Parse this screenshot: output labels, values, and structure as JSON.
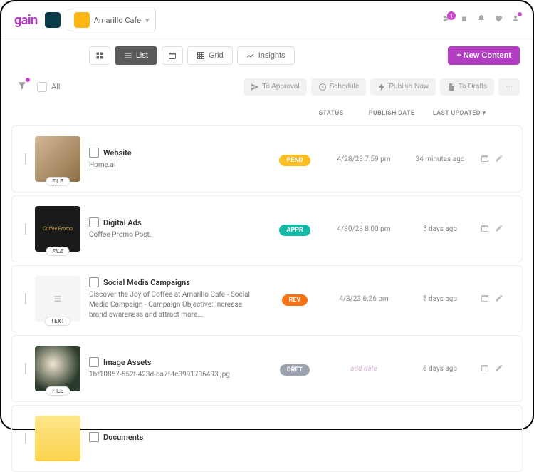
{
  "header": {
    "brand_name": "Amarillo Cafe",
    "nav_badge": "1"
  },
  "toolbar": {
    "list": "List",
    "grid": "Grid",
    "insights": "Insights",
    "new_content": "+  New Content"
  },
  "actions": {
    "all": "All",
    "to_approval": "To Approval",
    "schedule": "Schedule",
    "publish_now": "Publish Now",
    "to_drafts": "To Drafts"
  },
  "columns": {
    "status": "STATUS",
    "publish_date": "PUBLISH DATE",
    "last_updated": "LAST UPDATED ▾"
  },
  "items": [
    {
      "category": "Website",
      "title": "Home.ai",
      "status": "PEND",
      "status_class": "pill-pend",
      "date": "4/28/23 7:59 pm",
      "updated": "34 minutes ago",
      "thumb_class": "img1",
      "tag": "FILE"
    },
    {
      "category": "Digital Ads",
      "title": "Coffee Promo Post.",
      "status": "APPR",
      "status_class": "pill-appr",
      "date": "4/30/23 8:00 pm",
      "updated": "5 days ago",
      "thumb_class": "img2",
      "thumb_text": "Coffee Promo",
      "tag": "FILE"
    },
    {
      "category": "Social Media Campaigns",
      "title": "Discover the Joy of Coffee at Amarillo Cafe - Social Media Campaign - Campaign Objective: Increase brand awareness and attract more...",
      "status": "REV",
      "status_class": "pill-rev",
      "date": "4/3/23 6:26 pm",
      "updated": "5 days ago",
      "thumb_class": "text-thumb",
      "tag": "TEXT"
    },
    {
      "category": "Image Assets",
      "title": "1bf10857-552f-423d-ba7f-fc3991706493.jpg",
      "status": "DRFT",
      "status_class": "pill-drft",
      "date": "add date",
      "date_class": "add-date",
      "updated": "6 days ago",
      "thumb_class": "img4",
      "tag": "FILE"
    },
    {
      "category": "Documents",
      "title": "",
      "thumb_class": "img5"
    }
  ]
}
